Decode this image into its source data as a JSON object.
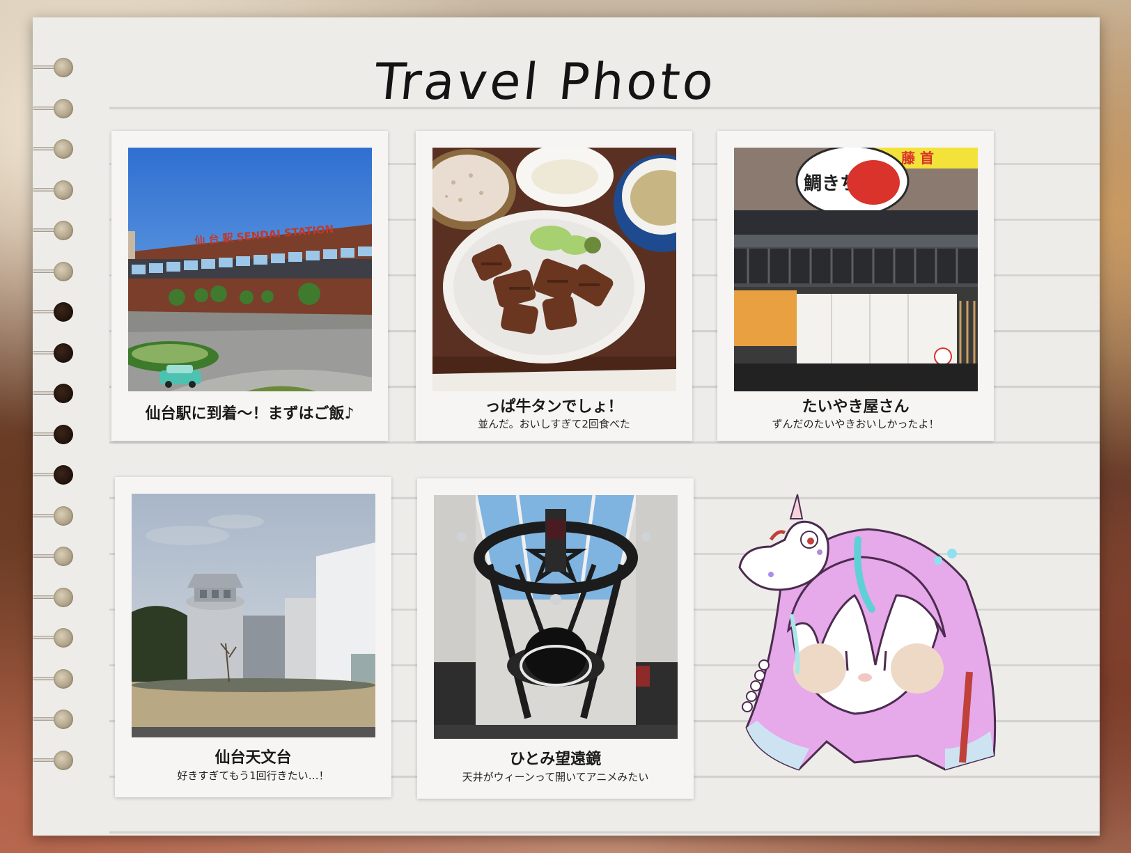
{
  "page": {
    "title": "Travel Photo",
    "paper_color": "#eeece9",
    "line_color": "#d3d2cf"
  },
  "photos": [
    {
      "id": "sendai-station",
      "caption": "仙台駅に到着〜！まずはご飯♪",
      "subcaption": "",
      "sign_text": "仙 台 駅   SENDAI STATION",
      "sign_color": "#c0392b"
    },
    {
      "id": "gyutan",
      "caption": "っぱ牛タンでしょ！",
      "subcaption": "並んだ。おいしすぎて2回食べた",
      "sign_text": "",
      "sign_color": ""
    },
    {
      "id": "taiyaki-shop",
      "caption": "たいやき屋さん",
      "subcaption": "ずんだのたいやきおいしかったよ！",
      "sign_text": "鯛きち",
      "sign_color": "#d9332b"
    },
    {
      "id": "observatory",
      "caption": "仙台天文台",
      "subcaption": "好きすぎてもう1回行きたい…！",
      "sign_text": "",
      "sign_color": ""
    },
    {
      "id": "telescope",
      "caption": "ひとみ望遠鏡",
      "subcaption": "天井がウィーンって開いてアニメみたい",
      "sign_text": "",
      "sign_color": ""
    }
  ],
  "decorations": {
    "spiral_ring_count": 18,
    "character": "chibi-unicorn-girl",
    "character_hair_color": "#e6a9ea",
    "character_accent_color": "#5fd0d6"
  }
}
